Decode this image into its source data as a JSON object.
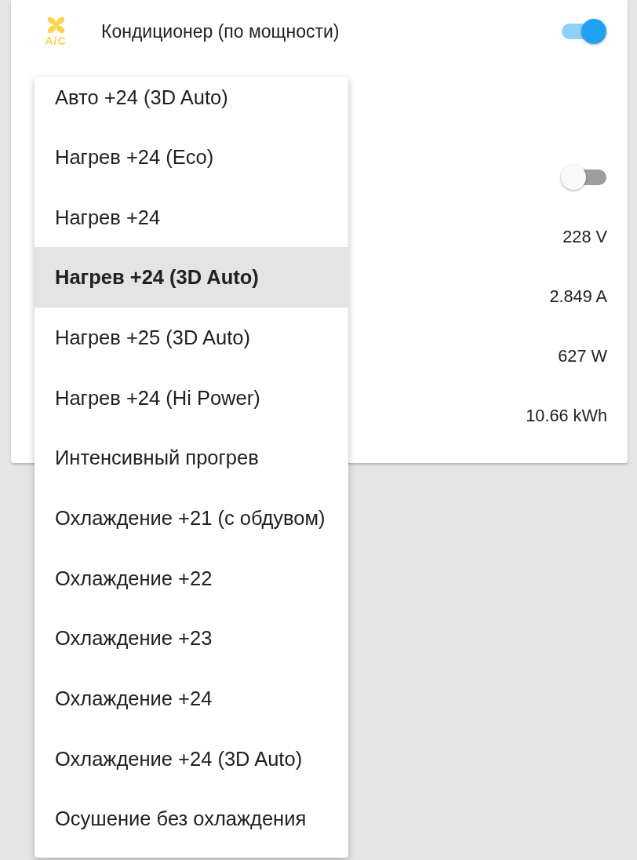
{
  "card": {
    "rows": [
      {
        "kind": "switch",
        "icon_caption": "A/C",
        "label": "Кондиционер (по мощности)",
        "on": true
      },
      {
        "kind": "switch",
        "on": false
      },
      {
        "kind": "sensor",
        "value": "228 V"
      },
      {
        "kind": "sensor",
        "value": "2.849 A"
      },
      {
        "kind": "sensor",
        "value": "627 W"
      },
      {
        "kind": "sensor",
        "value": "10.66 kWh"
      }
    ]
  },
  "menu": {
    "options": [
      {
        "label": "Авто +24 (3D Auto)",
        "selected": false
      },
      {
        "label": "Нагрев +24 (Eco)",
        "selected": false
      },
      {
        "label": "Нагрев +24",
        "selected": false
      },
      {
        "label": "Нагрев +24 (3D Auto)",
        "selected": true
      },
      {
        "label": "Нагрев +25 (3D Auto)",
        "selected": false
      },
      {
        "label": "Нагрев +24 (Hi Power)",
        "selected": false
      },
      {
        "label": "Интенсивный прогрев",
        "selected": false
      },
      {
        "label": "Охлаждение +21 (с обдувом)",
        "selected": false
      },
      {
        "label": "Охлаждение +22",
        "selected": false
      },
      {
        "label": "Охлаждение +23",
        "selected": false
      },
      {
        "label": "Охлаждение +24",
        "selected": false
      },
      {
        "label": "Охлаждение +24 (3D Auto)",
        "selected": false
      },
      {
        "label": "Осушение без охлаждения",
        "selected": false
      }
    ]
  }
}
